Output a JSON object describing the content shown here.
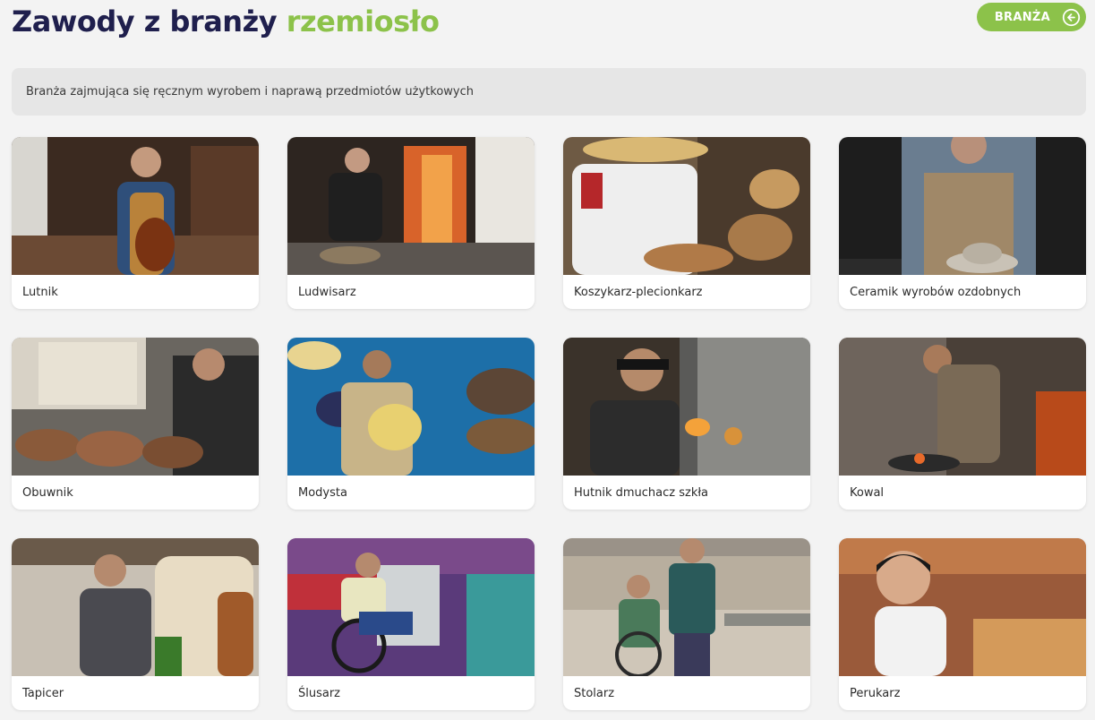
{
  "header": {
    "title_prefix": "Zawody z branży",
    "title_accent": "rzemiosło",
    "back_label": "BRANŻA",
    "accent_color": "#8cc24a",
    "title_color": "#1f1f4d"
  },
  "description": "Branża zajmująca się ręcznym wyrobem i naprawą przedmiotów użytkowych",
  "professions": [
    {
      "name": "Lutnik",
      "image": "violin-maker-photo"
    },
    {
      "name": "Ludwisarz",
      "image": "bell-founder-photo"
    },
    {
      "name": "Koszykarz-plecionkarz",
      "image": "basket-weaver-photo"
    },
    {
      "name": "Ceramik wyrobów ozdobnych",
      "image": "ceramicist-photo"
    },
    {
      "name": "Obuwnik",
      "image": "shoemaker-photo"
    },
    {
      "name": "Modysta",
      "image": "milliner-photo"
    },
    {
      "name": "Hutnik dmuchacz szkła",
      "image": "glassblower-photo"
    },
    {
      "name": "Kowal",
      "image": "blacksmith-photo"
    },
    {
      "name": "Tapicer",
      "image": "upholsterer-photo"
    },
    {
      "name": "Ślusarz",
      "image": "locksmith-photo"
    },
    {
      "name": "Stolarz",
      "image": "carpenter-photo"
    },
    {
      "name": "Perukarz",
      "image": "wigmaker-photo"
    }
  ]
}
